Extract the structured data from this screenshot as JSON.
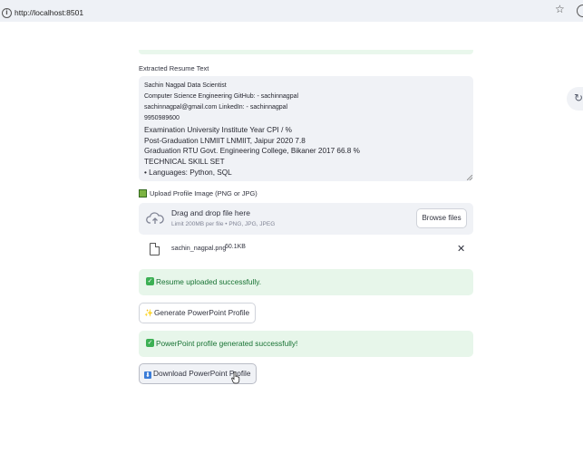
{
  "browser": {
    "url": "http://localhost:8501"
  },
  "extract": {
    "label": "Extracted Resume Text",
    "lines_small": [
      "Sachin Nagpal Data Scientist",
      "Computer Science Engineering GitHub: - sachinnagpal",
      "sachinnagpal@gmail.com LinkedIn: - sachinnagpal",
      "9950989600"
    ],
    "lines_big": [
      "Examination University Institute Year CPI / %",
      "Post-Graduation LNMIIT LNMIIT, Jaipur 2020 7.8",
      "Graduation RTU Govt. Engineering College, Bikaner 2017 66.8 %",
      "TECHNICAL SKILL SET",
      "• Languages: Python, SQL"
    ]
  },
  "upload": {
    "label": "Upload Profile Image (PNG or JPG)",
    "drop_title": "Drag and drop file here",
    "drop_sub": "Limit 200MB per file • PNG, JPG, JPEG",
    "browse_label": "Browse files",
    "file_name": "sachin_nagpal.png",
    "file_size": "60.1KB"
  },
  "alerts": {
    "uploaded": "Resume uploaded successfully.",
    "generated": "PowerPoint profile generated successfully!"
  },
  "buttons": {
    "generate": "Generate PowerPoint Profile",
    "download": "Download PowerPoint Profile"
  },
  "icons": {
    "info": "info-icon",
    "star": "star-icon",
    "refresh": "refresh-icon",
    "cloud_upload": "cloud-upload-icon",
    "file": "file-icon",
    "close": "close-icon",
    "check": "check-icon",
    "sparkles": "sparkles-icon",
    "download": "download-icon"
  },
  "colors": {
    "success_bg": "#e7f6ea",
    "success_text": "#177233",
    "panel_bg": "#f0f2f6"
  }
}
